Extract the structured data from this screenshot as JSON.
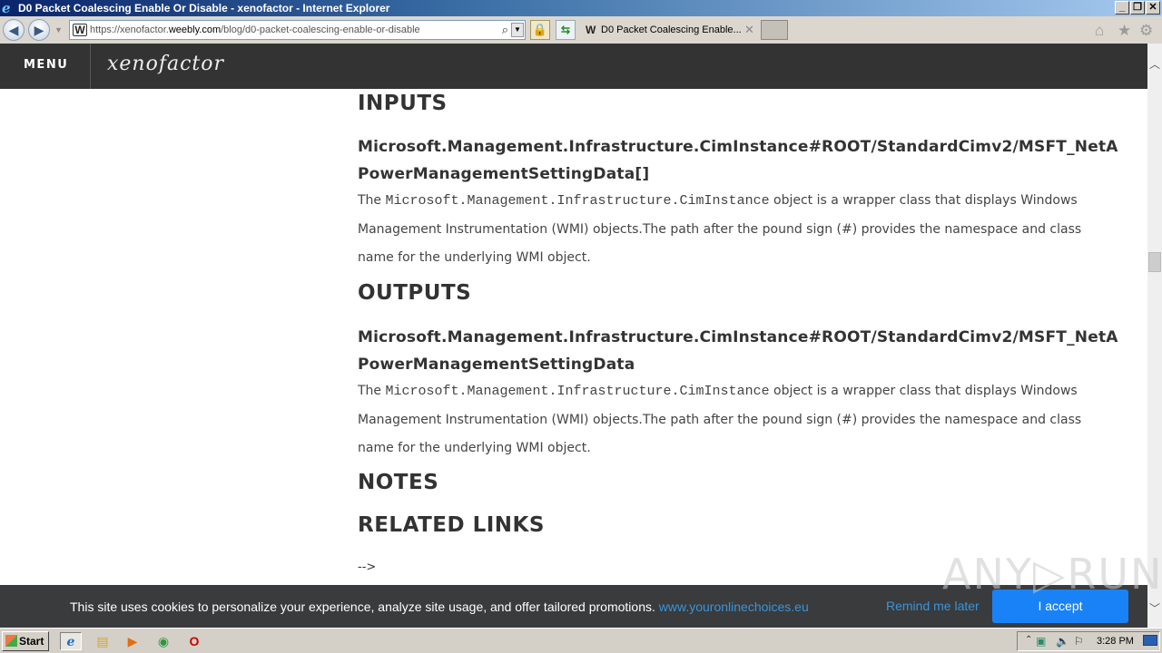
{
  "window": {
    "title": "D0 Packet Coalescing Enable Or Disable - xenofactor - Internet Explorer",
    "controls": {
      "minimize": "_",
      "restore": "❐",
      "close": "✕"
    }
  },
  "browser": {
    "url_prefix": "https://xenofactor.",
    "url_domain": "weebly.com",
    "url_path": "/blog/d0-packet-coalescing-enable-or-disable",
    "tab_label": "D0 Packet Coalescing Enable...",
    "icons": {
      "back": "back-icon",
      "forward": "forward-icon",
      "search": "search-icon",
      "lock": "lock-icon",
      "refresh": "refresh-icon",
      "home": "home-icon",
      "favorites": "star-icon",
      "tools": "gear-icon"
    }
  },
  "site": {
    "menu_label": "MENU",
    "logo": "xenofactor"
  },
  "article": {
    "inputs_heading": "INPUTS",
    "inputs_type_line1": "Microsoft.Management.Infrastructure.CimInstance#ROOT/StandardCimv2/MSFT_NetAdapterPowerManagementSettingData[]",
    "inputs_type_line2": "PowerManagementSettingData[]",
    "inputs_desc_prefix": "The ",
    "inputs_desc_code": "Microsoft.Management.Infrastructure.CimInstance",
    "inputs_desc_rest": " object is a wrapper class that displays Windows Management Instrumentation (WMI) objects.The path after the pound sign (#) provides the namespace and class name for the underlying WMI object.",
    "outputs_heading": "OUTPUTS",
    "outputs_type_line1": "Microsoft.Management.Infrastructure.CimInstance#ROOT/StandardCimv2/MSFT_NetAdapterPowerManagementSettingData",
    "outputs_type_line2": "PowerManagementSettingData",
    "outputs_desc_prefix": "The ",
    "outputs_desc_code": "Microsoft.Management.Infrastructure.CimInstance",
    "outputs_desc_rest": " object is a wrapper class that displays Windows Management Instrumentation (WMI) objects.The path after the pound sign (#) provides the namespace and class name for the underlying WMI object.",
    "notes_heading": "NOTES",
    "related_heading": "RELATED LINKS",
    "trailing_text": "-->"
  },
  "cookie_banner": {
    "text": "This site uses cookies to personalize your experience, analyze site usage, and offer tailored promotions. ",
    "link": "www.youronlinechoices.eu",
    "remind_label": "Remind me later",
    "accept_label": "I accept",
    "accept_color": "#1a82f7",
    "link_color": "#3b94d9"
  },
  "watermark": "ANY▷RUN",
  "taskbar": {
    "start_label": "Start",
    "apps": [
      "internet-explorer",
      "file-explorer",
      "media-player",
      "chrome",
      "opera"
    ],
    "clock": "3:28 PM"
  }
}
